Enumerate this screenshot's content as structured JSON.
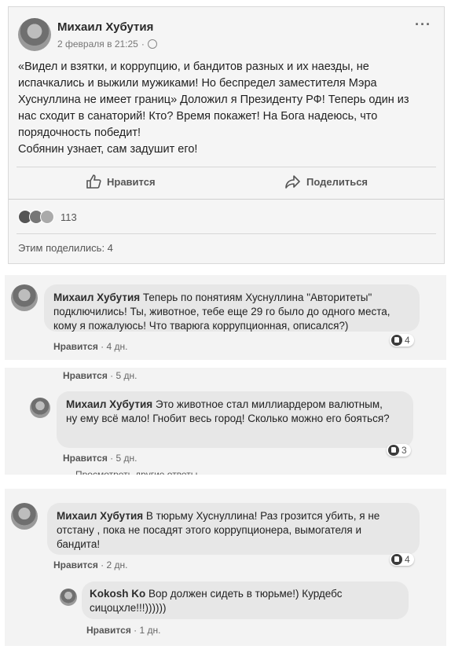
{
  "post": {
    "author": "Михаил Хубутия",
    "date": "2 февраля в 21:25",
    "privacy_icon": "globe-icon",
    "more": "···",
    "text": "«Видел и взятки, и коррупцию, и бандитов разных и их наезды, не испачкались и выжили мужиками! Но беспредел заместителя Мэра Хуснуллина не имеет границ» Доложил я Президенту РФ! Теперь один из нас сходит в санаторий! Кто? Время покажет! На Бога надеюсь, что порядочность победит!\nСобянин узнает, сам задушит его!",
    "like_label": "Нравится",
    "share_label": "Поделиться",
    "reactions_count": "113",
    "shares_label": "Этим поделились: 4"
  },
  "comments": [
    {
      "author": "Михаил Хубутия",
      "text": "Теперь по понятиям Хуснуллина \"Авторитеты\" подключились! Ты, животное, тебе еще 29 го было до одного места, кому я пожалуюсь! Что тварюга коррупционная, описался?)",
      "like": "Нравится",
      "time": "4 дн.",
      "likes": "4"
    },
    {
      "prev_like": "Нравится",
      "prev_time": "5 дн.",
      "author": "Михаил Хубутия",
      "text": "Это животное стал миллиардером валютным, ну ему всё мало! Гнобит весь город! Сколько можно его бояться?",
      "like": "Нравится",
      "time": "5 дн.",
      "likes": "3",
      "more_replies": "Просмотреть другие ответы"
    },
    {
      "author": "Михаил Хубутия",
      "text": "В тюрьму Хуснуллина! Раз грозится убить, я не отстану , пока не посадят этого коррупционера, вымогателя и бандита!",
      "like": "Нравится",
      "time": "2 дн.",
      "likes": "4",
      "reply": {
        "author": "Kokosh Ko",
        "text": "Вор должен сидеть в тюрьме!) Курдебс сицоцхле!!!))))))",
        "like": "Нравится",
        "time": "1 дн."
      }
    }
  ],
  "separator": "·"
}
